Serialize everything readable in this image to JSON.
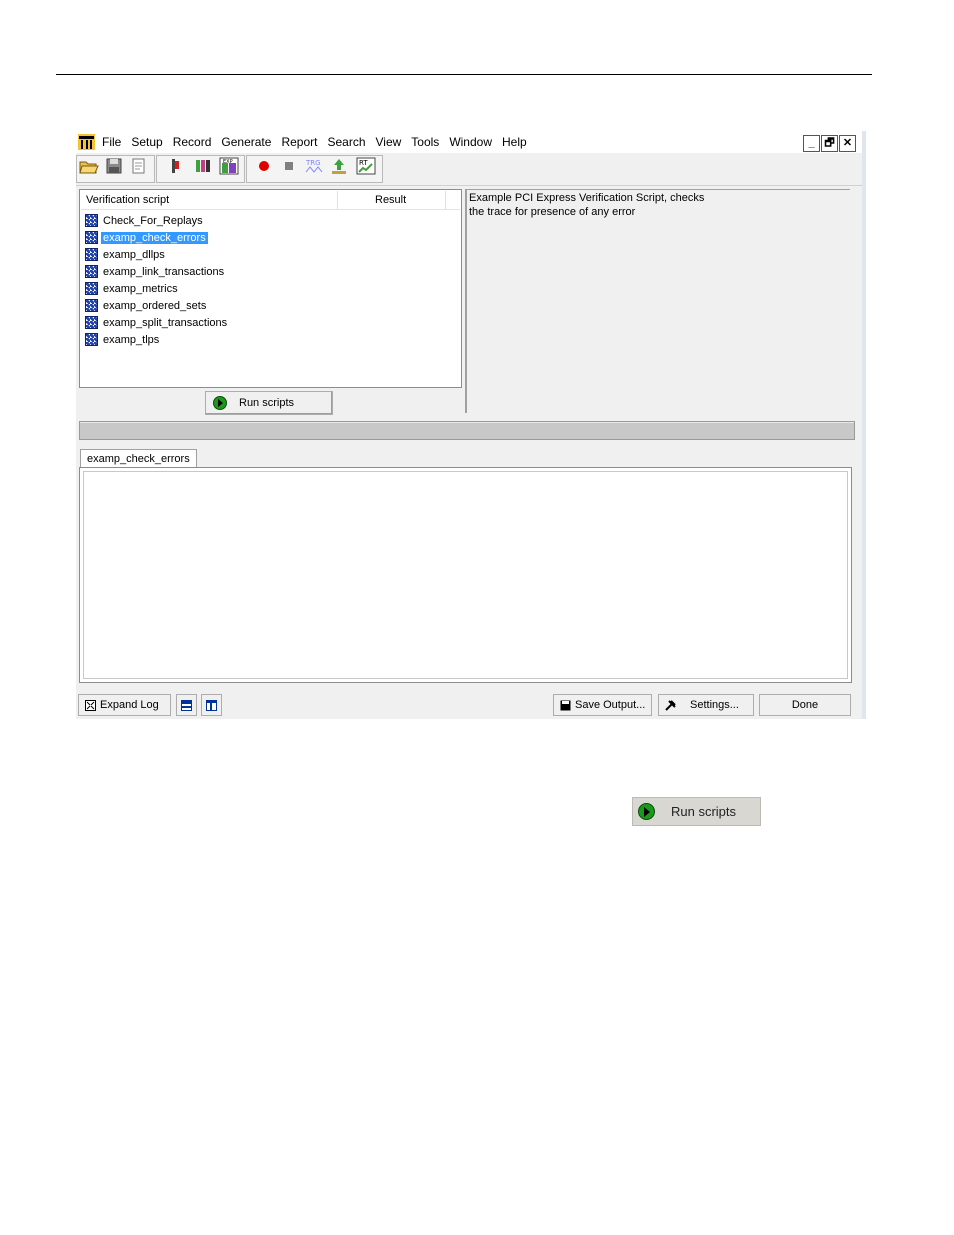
{
  "menu": {
    "items": [
      "File",
      "Setup",
      "Record",
      "Generate",
      "Report",
      "Search",
      "View",
      "Tools",
      "Window",
      "Help"
    ]
  },
  "window_buttons": {
    "minimize": "_",
    "restore": "🗗",
    "close": "✕"
  },
  "toolbar": {
    "icons": [
      "open-folder-icon",
      "save-icon",
      "edit-icon",
      "tool-icon",
      "filter-icon",
      "exp-icon",
      "record-icon",
      "stop-icon",
      "trigger-icon",
      "upload-icon",
      "realtime-icon"
    ],
    "trg_label": "TRG",
    "rt_label": "RT",
    "exp_label": "EXP"
  },
  "scripts": {
    "col_script": "Verification script",
    "col_result": "Result",
    "items": [
      {
        "name": "Check_For_Replays",
        "selected": false
      },
      {
        "name": "examp_check_errors",
        "selected": true
      },
      {
        "name": "examp_dllps",
        "selected": false
      },
      {
        "name": "examp_link_transactions",
        "selected": false
      },
      {
        "name": "examp_metrics",
        "selected": false
      },
      {
        "name": "examp_ordered_sets",
        "selected": false
      },
      {
        "name": "examp_split_transactions",
        "selected": false
      },
      {
        "name": "examp_tlps",
        "selected": false
      }
    ]
  },
  "description": {
    "line1": "Example PCI Express Verification Script, checks",
    "line2": "the trace for presence of any error"
  },
  "run_button": {
    "label": "Run scripts"
  },
  "progress": {
    "value": 0
  },
  "log_tab": {
    "label": "examp_check_errors"
  },
  "bottom": {
    "expand_log": "Expand Log",
    "save_output": "Save Output...",
    "settings": "Settings...",
    "done": "Done"
  },
  "standalone_button": {
    "label": "Run scripts"
  },
  "colors": {
    "selection": "#3399ff",
    "play_green": "#1a9a1a",
    "record_red": "#e00000"
  }
}
